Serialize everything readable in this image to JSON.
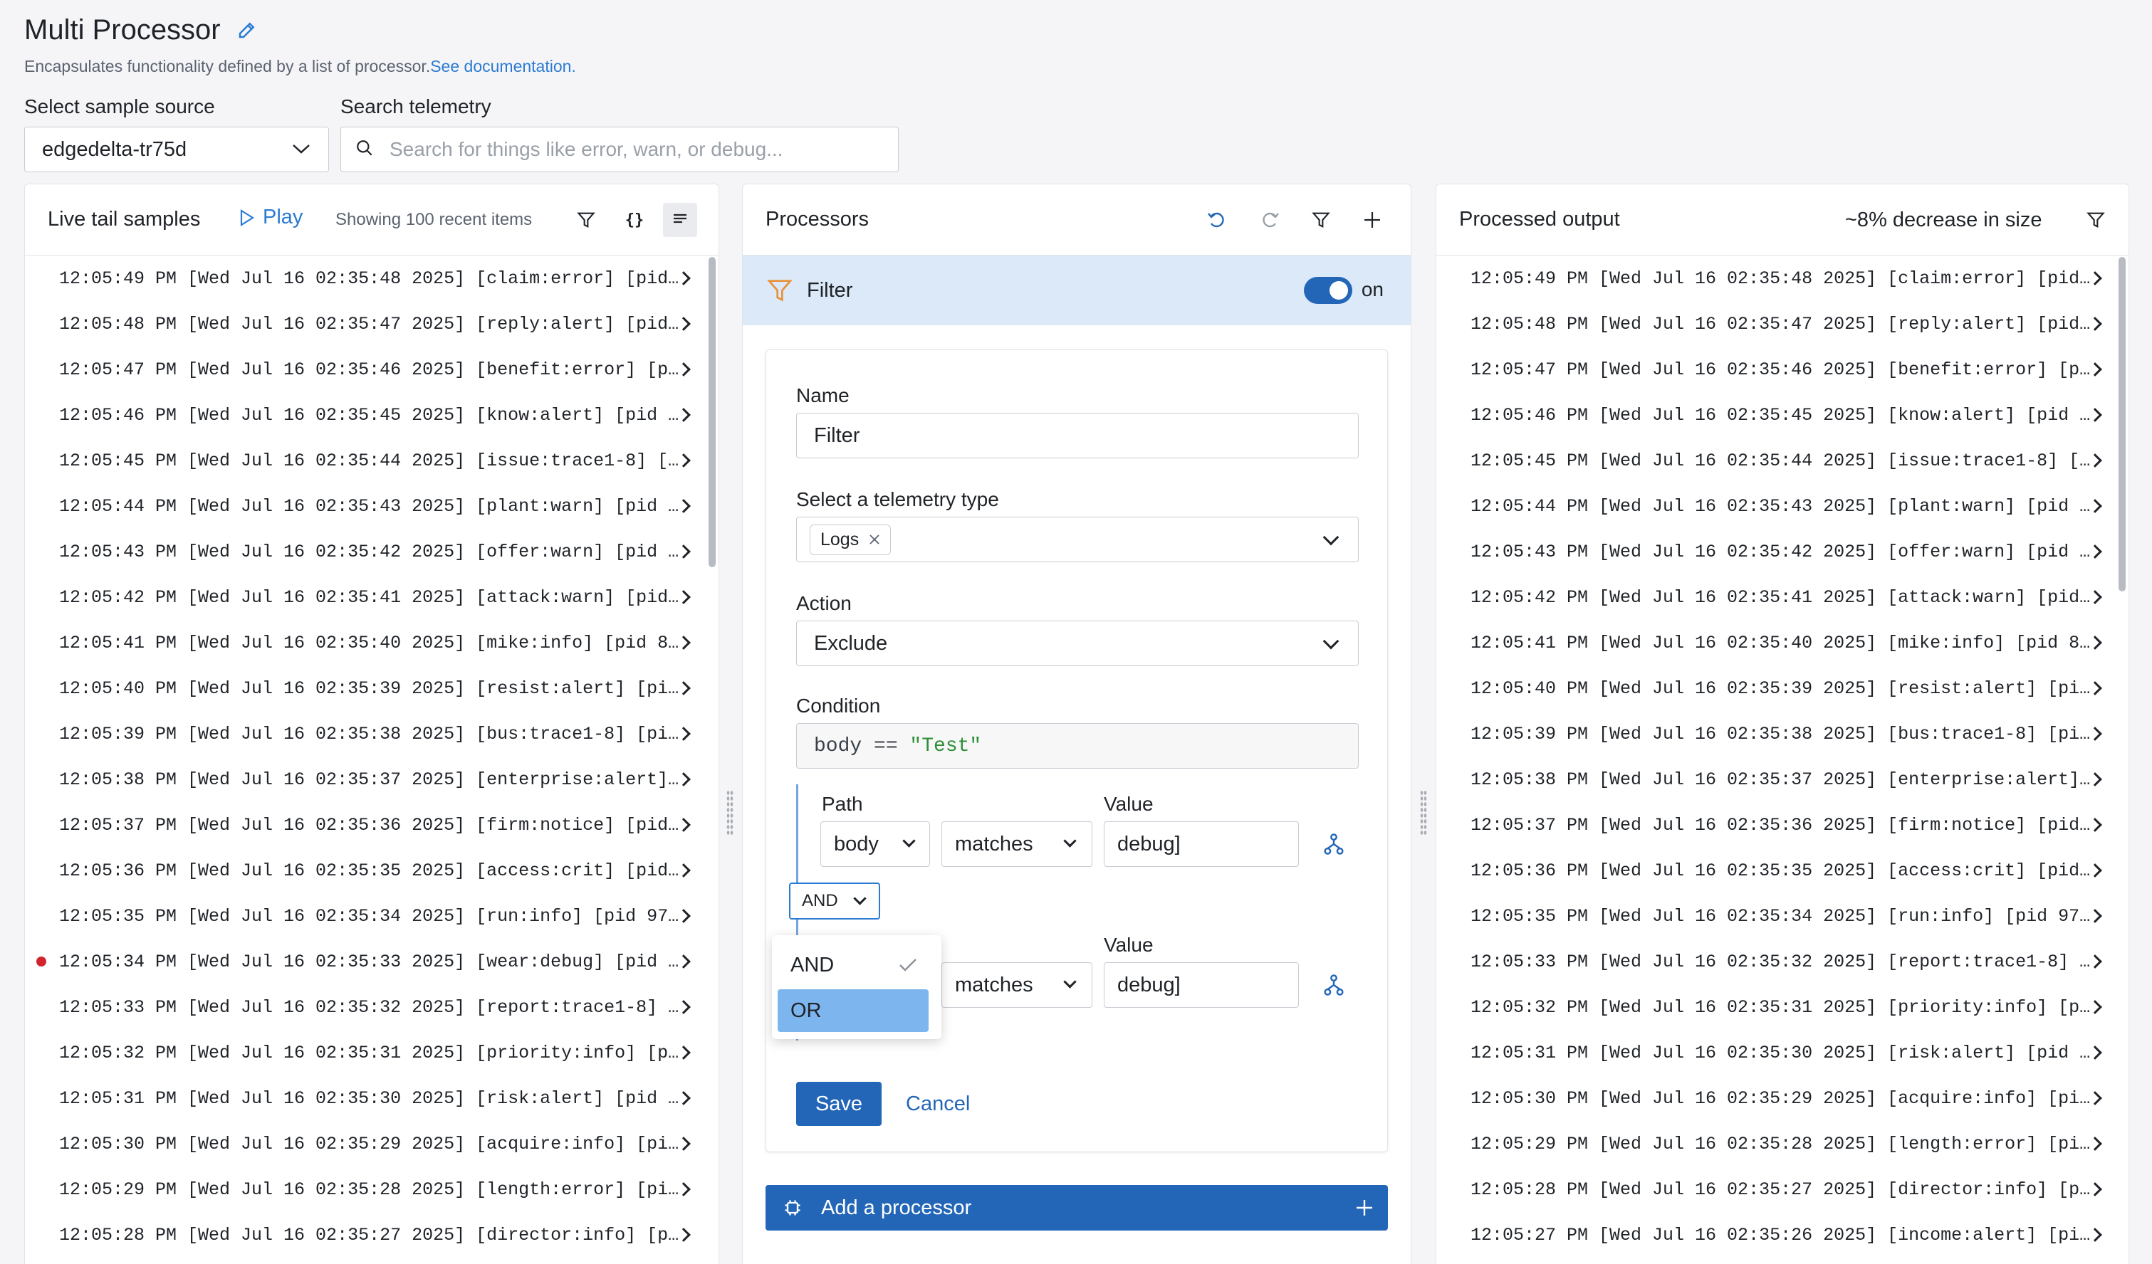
{
  "header": {
    "title": "Multi Processor",
    "description": "Encapsulates functionality defined by a list of processor.",
    "doc_link": "See documentation.",
    "sample_source_label": "Select sample source",
    "sample_source_value": "edgedelta-tr75d",
    "search_label": "Search telemetry",
    "search_placeholder": "Search for things like error, warn, or debug..."
  },
  "live_tail": {
    "title": "Live tail samples",
    "play_label": "Play",
    "showing": "Showing 100 recent items",
    "rows": [
      "12:05:49 PM [Wed Jul 16 02:35:48 2025] [claim:error] [pid…",
      "12:05:48 PM [Wed Jul 16 02:35:47 2025] [reply:alert] [pid…",
      "12:05:47 PM [Wed Jul 16 02:35:46 2025] [benefit:error] [p…",
      "12:05:46 PM [Wed Jul 16 02:35:45 2025] [know:alert] [pid …",
      "12:05:45 PM [Wed Jul 16 02:35:44 2025] [issue:trace1-8] […",
      "12:05:44 PM [Wed Jul 16 02:35:43 2025] [plant:warn] [pid …",
      "12:05:43 PM [Wed Jul 16 02:35:42 2025] [offer:warn] [pid …",
      "12:05:42 PM [Wed Jul 16 02:35:41 2025] [attack:warn] [pid…",
      "12:05:41 PM [Wed Jul 16 02:35:40 2025] [mike:info] [pid 8…",
      "12:05:40 PM [Wed Jul 16 02:35:39 2025] [resist:alert] [pi…",
      "12:05:39 PM [Wed Jul 16 02:35:38 2025] [bus:trace1-8] [pi…",
      "12:05:38 PM [Wed Jul 16 02:35:37 2025] [enterprise:alert]…",
      "12:05:37 PM [Wed Jul 16 02:35:36 2025] [firm:notice] [pid…",
      "12:05:36 PM [Wed Jul 16 02:35:35 2025] [access:crit] [pid…",
      "12:05:35 PM [Wed Jul 16 02:35:34 2025] [run:info] [pid 97…",
      "12:05:34 PM [Wed Jul 16 02:35:33 2025] [wear:debug] [pid …",
      "12:05:33 PM [Wed Jul 16 02:35:32 2025] [report:trace1-8] …",
      "12:05:32 PM [Wed Jul 16 02:35:31 2025] [priority:info] [p…",
      "12:05:31 PM [Wed Jul 16 02:35:30 2025] [risk:alert] [pid …",
      "12:05:30 PM [Wed Jul 16 02:35:29 2025] [acquire:info] [pi…",
      "12:05:29 PM [Wed Jul 16 02:35:28 2025] [length:error] [pi…",
      "12:05:28 PM [Wed Jul 16 02:35:27 2025] [director:info] [p…"
    ],
    "highlighted_row_index": 15
  },
  "processors": {
    "title": "Processors",
    "filter_label": "Filter",
    "toggle_label": "on",
    "form": {
      "name_label": "Name",
      "name_value": "Filter",
      "telemetry_label": "Select a telemetry type",
      "telemetry_tag": "Logs",
      "action_label": "Action",
      "action_value": "Exclude",
      "condition_label": "Condition",
      "condition_code_left": "body == ",
      "condition_code_string": "\"Test\"",
      "path_label": "Path",
      "value_label_1": "Value",
      "path_value": "body",
      "operator_1": "matches",
      "value_1": "debug]",
      "group_operator": "AND",
      "value_label_2": "Value",
      "operator_2": "matches",
      "value_2": "debug]",
      "menu_options": [
        "AND",
        "OR"
      ],
      "save_label": "Save",
      "cancel_label": "Cancel"
    },
    "add_processor_label": "Add a processor"
  },
  "output": {
    "title": "Processed output",
    "size_change": "~8% decrease in size",
    "rows": [
      "12:05:49 PM [Wed Jul 16 02:35:48 2025] [claim:error] [pid…",
      "12:05:48 PM [Wed Jul 16 02:35:47 2025] [reply:alert] [pid…",
      "12:05:47 PM [Wed Jul 16 02:35:46 2025] [benefit:error] [p…",
      "12:05:46 PM [Wed Jul 16 02:35:45 2025] [know:alert] [pid …",
      "12:05:45 PM [Wed Jul 16 02:35:44 2025] [issue:trace1-8] […",
      "12:05:44 PM [Wed Jul 16 02:35:43 2025] [plant:warn] [pid …",
      "12:05:43 PM [Wed Jul 16 02:35:42 2025] [offer:warn] [pid …",
      "12:05:42 PM [Wed Jul 16 02:35:41 2025] [attack:warn] [pid…",
      "12:05:41 PM [Wed Jul 16 02:35:40 2025] [mike:info] [pid 8…",
      "12:05:40 PM [Wed Jul 16 02:35:39 2025] [resist:alert] [pi…",
      "12:05:39 PM [Wed Jul 16 02:35:38 2025] [bus:trace1-8] [pi…",
      "12:05:38 PM [Wed Jul 16 02:35:37 2025] [enterprise:alert]…",
      "12:05:37 PM [Wed Jul 16 02:35:36 2025] [firm:notice] [pid…",
      "12:05:36 PM [Wed Jul 16 02:35:35 2025] [access:crit] [pid…",
      "12:05:35 PM [Wed Jul 16 02:35:34 2025] [run:info] [pid 97…",
      "12:05:33 PM [Wed Jul 16 02:35:32 2025] [report:trace1-8] …",
      "12:05:32 PM [Wed Jul 16 02:35:31 2025] [priority:info] [p…",
      "12:05:31 PM [Wed Jul 16 02:35:30 2025] [risk:alert] [pid …",
      "12:05:30 PM [Wed Jul 16 02:35:29 2025] [acquire:info] [pi…",
      "12:05:29 PM [Wed Jul 16 02:35:28 2025] [length:error] [pi…",
      "12:05:28 PM [Wed Jul 16 02:35:27 2025] [director:info] [p…",
      "12:05:27 PM [Wed Jul 16 02:35:26 2025] [income:alert] [pi…"
    ]
  },
  "colors": {
    "accent": "#2366b8",
    "link": "#2b7bd3",
    "selected_bg": "#dbe9f8",
    "error_dot": "#d1242f",
    "string_green": "#2f8f3a"
  },
  "icons": [
    "edit-icon",
    "search-icon",
    "play-icon",
    "filter-icon",
    "json-icon",
    "text-icon",
    "undo-icon",
    "redo-icon",
    "plus-icon",
    "funnel-icon",
    "close-icon",
    "chevron-down-icon",
    "chevron-right-icon",
    "checkmark-icon",
    "branch-icon",
    "processor-icon"
  ]
}
